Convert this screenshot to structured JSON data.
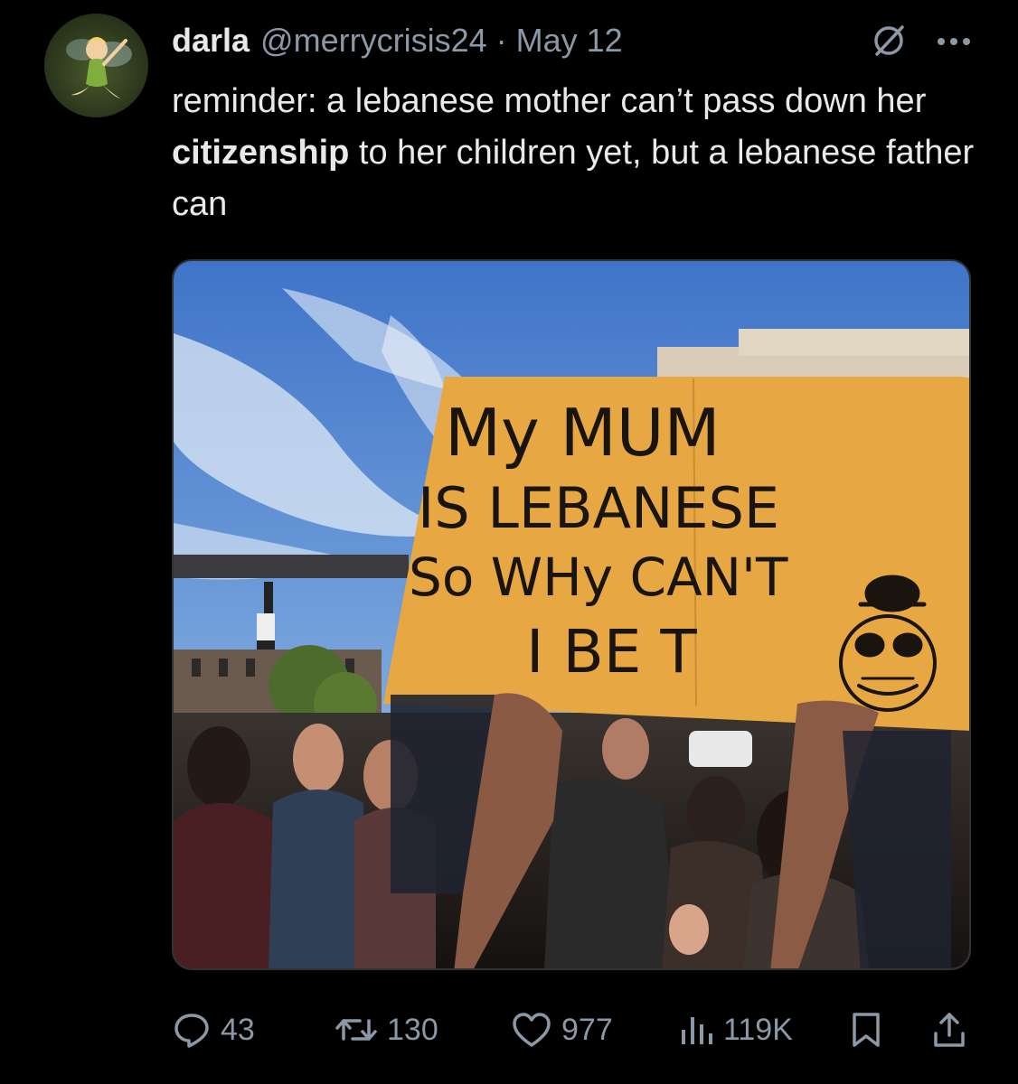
{
  "tweet": {
    "author_name": "darla",
    "author_handle": "@merrycrisis24",
    "separator": "·",
    "date": "May 12",
    "text_before": "reminder:  a lebanese mother can’t pass down her ",
    "text_bold": "citizenship",
    "text_after": " to her children yet, but a lebanese father can"
  },
  "image": {
    "sign_lines": [
      "My MUM",
      "IS LEBANESE",
      "So WHy  CAN'T",
      "I BE  T"
    ]
  },
  "actions": {
    "replies": "43",
    "reposts": "130",
    "likes": "977",
    "views": "119K"
  },
  "colors": {
    "background": "#000000",
    "text": "#e7e9ea",
    "muted": "#8b98a5",
    "border": "#2f3336",
    "sign": "#e7a843"
  },
  "icons": [
    "grok-icon",
    "more-icon",
    "reply-icon",
    "repost-icon",
    "like-icon",
    "views-icon",
    "bookmark-icon",
    "share-icon"
  ]
}
